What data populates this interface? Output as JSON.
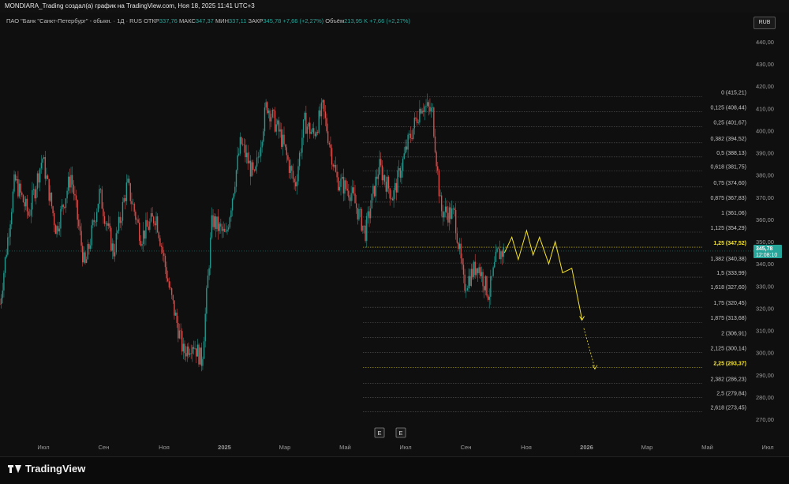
{
  "header": {
    "title": "MONDIARA_Trading создал(а) график на TradingView.com, Ноя 18, 2025 11:41 UTC+3"
  },
  "legend": {
    "symbol": "ПАО \"Банк \"Санкт-Петербург\" - обыкн. · 1Д · RUS",
    "open_label": "ОТКР",
    "open": "337,76",
    "high_label": "МАКС",
    "high": "347,37",
    "low_label": "МИН",
    "low": "337,11",
    "close_label": "ЗАКР",
    "close": "345,78",
    "change": "+7,66 (+2,27%)",
    "volume_label": "Объём",
    "volume": "213,95 K",
    "volume_change": "+7,66 (+2,27%)"
  },
  "currency": "RUB",
  "price_badge": {
    "price": "345,78",
    "timer": "12:08:10"
  },
  "events": [
    "E",
    "E"
  ],
  "footer": {
    "brand": "TradingView"
  },
  "colors": {
    "up": "#26a69a",
    "down": "#ef5350",
    "projection": "#f5e32a",
    "fib": "#9a9a9a",
    "badge": "#26a69a"
  },
  "chart_data": {
    "type": "candlestick",
    "y_axis_ticks": [
      440,
      430,
      420,
      410,
      400,
      390,
      380,
      370,
      360,
      350,
      340,
      330,
      320,
      310,
      300,
      290,
      280,
      270
    ],
    "y_tick_labels": [
      "440,00",
      "430,00",
      "420,00",
      "410,00",
      "400,00",
      "390,00",
      "380,00",
      "370,00",
      "360,00",
      "350,00",
      "340,00",
      "330,00",
      "320,00",
      "310,00",
      "300,00",
      "290,00",
      "280,00",
      "270,00"
    ],
    "ylim": [
      264,
      446
    ],
    "x_axis_labels": [
      "Июл",
      "Сен",
      "Ноя",
      "2025",
      "Мар",
      "Май",
      "Июл",
      "Сен",
      "Ноя",
      "2026",
      "Мар",
      "Май",
      "Июл"
    ],
    "x_range": [
      "2024-05-20",
      "2026-08-15"
    ],
    "fib_levels": [
      {
        "label": "0 (415,21)",
        "value": 415.21
      },
      {
        "label": "0,125 (408,44)",
        "value": 408.44
      },
      {
        "label": "0,25 (401,67)",
        "value": 401.67
      },
      {
        "label": "0,382 (394,52)",
        "value": 394.52
      },
      {
        "label": "0,5 (388,13)",
        "value": 388.13
      },
      {
        "label": "0,618 (381,75)",
        "value": 381.75
      },
      {
        "label": "0,75 (374,60)",
        "value": 374.6
      },
      {
        "label": "0,875 (367,83)",
        "value": 367.83
      },
      {
        "label": "1 (361,06)",
        "value": 361.06
      },
      {
        "label": "1,125 (354,29)",
        "value": 354.29
      },
      {
        "label": "1,25 (347,52)",
        "value": 347.52,
        "highlight": true
      },
      {
        "label": "1,382 (340,38)",
        "value": 340.38
      },
      {
        "label": "1,5 (333,99)",
        "value": 333.99
      },
      {
        "label": "1,618 (327,60)",
        "value": 327.6
      },
      {
        "label": "1,75 (320,45)",
        "value": 320.45
      },
      {
        "label": "1,875 (313,68)",
        "value": 313.68
      },
      {
        "label": "2 (306,91)",
        "value": 306.91
      },
      {
        "label": "2,125 (300,14)",
        "value": 300.14
      },
      {
        "label": "2,25 (293,37)",
        "value": 293.37,
        "highlight": true
      },
      {
        "label": "2,382 (286,23)",
        "value": 286.23
      },
      {
        "label": "2,5 (279,84)",
        "value": 279.84
      },
      {
        "label": "2,618 (273,45)",
        "value": 273.45
      }
    ],
    "price_path": [
      [
        "2024-05-20",
        322
      ],
      [
        "2024-06-05",
        378
      ],
      [
        "2024-06-20",
        362
      ],
      [
        "2024-07-05",
        388
      ],
      [
        "2024-07-20",
        355
      ],
      [
        "2024-08-05",
        380
      ],
      [
        "2024-08-20",
        338
      ],
      [
        "2024-09-05",
        372
      ],
      [
        "2024-09-20",
        345
      ],
      [
        "2024-10-05",
        376
      ],
      [
        "2024-10-20",
        352
      ],
      [
        "2024-11-05",
        362
      ],
      [
        "2024-11-20",
        328
      ],
      [
        "2024-12-05",
        300
      ],
      [
        "2024-12-15",
        305
      ],
      [
        "2024-12-25",
        296
      ],
      [
        "2025-01-05",
        360
      ],
      [
        "2025-01-20",
        352
      ],
      [
        "2025-02-05",
        395
      ],
      [
        "2025-02-20",
        378
      ],
      [
        "2025-03-05",
        412
      ],
      [
        "2025-03-20",
        398
      ],
      [
        "2025-04-05",
        375
      ],
      [
        "2025-04-15",
        404
      ],
      [
        "2025-04-25",
        398
      ],
      [
        "2025-05-05",
        410
      ],
      [
        "2025-05-20",
        378
      ],
      [
        "2025-06-05",
        372
      ],
      [
        "2025-06-20",
        354
      ],
      [
        "2025-07-05",
        384
      ],
      [
        "2025-07-20",
        370
      ],
      [
        "2025-08-05",
        394
      ],
      [
        "2025-08-20",
        412
      ],
      [
        "2025-09-01",
        408
      ],
      [
        "2025-09-10",
        364
      ],
      [
        "2025-09-25",
        362
      ],
      [
        "2025-10-05",
        330
      ],
      [
        "2025-10-20",
        340
      ],
      [
        "2025-11-01",
        326
      ],
      [
        "2025-11-10",
        344
      ],
      [
        "2025-11-18",
        345.78
      ]
    ],
    "projection_path": [
      [
        "2025-11-18",
        345
      ],
      [
        "2025-11-26",
        352
      ],
      [
        "2025-12-03",
        342
      ],
      [
        "2025-12-12",
        355
      ],
      [
        "2025-12-19",
        344
      ],
      [
        "2025-12-26",
        352
      ],
      [
        "2026-01-05",
        340
      ],
      [
        "2026-01-12",
        350
      ],
      [
        "2026-01-20",
        336
      ],
      [
        "2026-01-30",
        338
      ],
      [
        "2026-02-10",
        315
      ]
    ],
    "projection_dotted": [
      [
        "2026-02-12",
        311
      ],
      [
        "2026-02-24",
        293
      ]
    ],
    "last_price": 345.78
  }
}
